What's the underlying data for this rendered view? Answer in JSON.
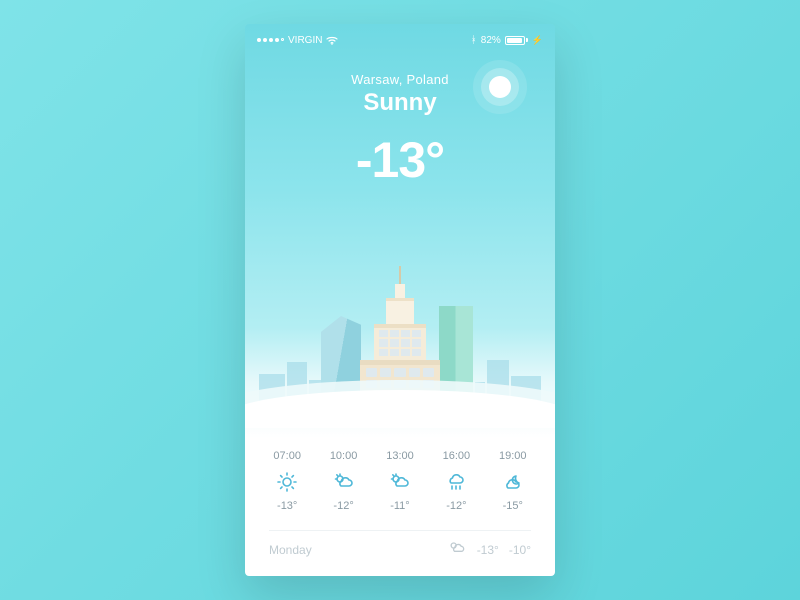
{
  "status": {
    "carrier": "VIRGIN",
    "battery_pct": "82%"
  },
  "current": {
    "location": "Warsaw, Poland",
    "condition": "Sunny",
    "temperature": "-13°"
  },
  "hourly": [
    {
      "time": "07:00",
      "icon": "sun",
      "temp": "-13°"
    },
    {
      "time": "10:00",
      "icon": "sun-cloud",
      "temp": "-12°"
    },
    {
      "time": "13:00",
      "icon": "sun-cloud",
      "temp": "-11°"
    },
    {
      "time": "16:00",
      "icon": "snow",
      "temp": "-12°"
    },
    {
      "time": "19:00",
      "icon": "moon-cloud",
      "temp": "-15°"
    }
  ],
  "daily": {
    "day": "Monday",
    "icon": "sun-cloud",
    "high": "-13°",
    "low": "-10°"
  }
}
